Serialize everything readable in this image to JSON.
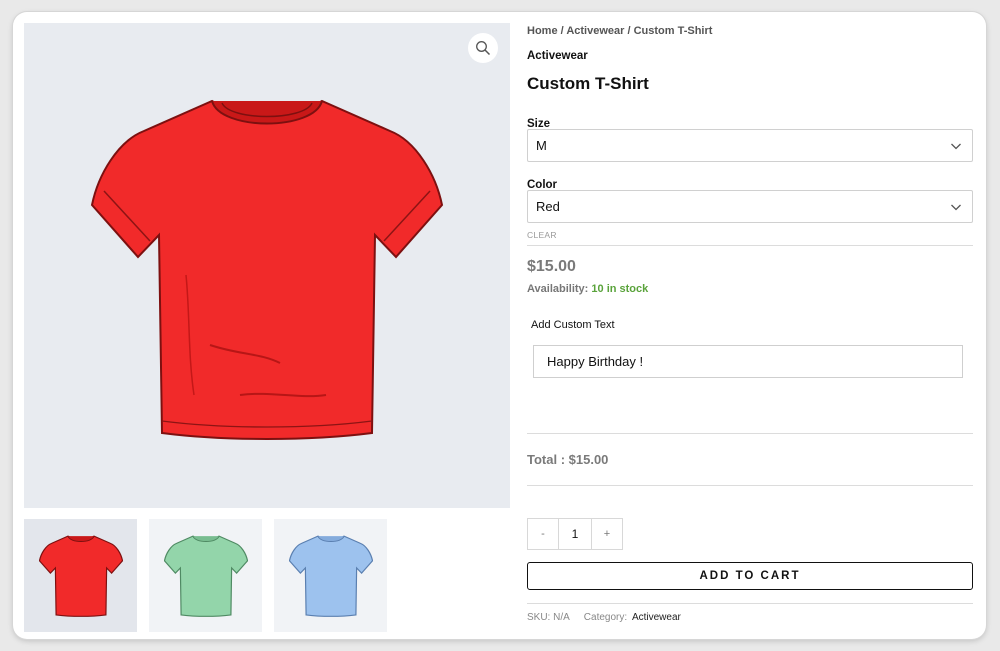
{
  "breadcrumb": {
    "home": "Home",
    "sep": " / ",
    "category": "Activewear",
    "current": "Custom T-Shirt"
  },
  "product": {
    "brand": "Activewear",
    "title": "Custom T-Shirt",
    "size_label": "Size",
    "size_value": "M",
    "color_label": "Color",
    "color_value": "Red",
    "clear_label": "CLEAR",
    "price": "$15.00",
    "availability_label": "Availability:",
    "availability_value": "10 in stock",
    "custom_text_label": "Add Custom Text",
    "custom_text_value": "Happy Birthday !",
    "total": "Total : $15.00",
    "qty_minus": "-",
    "qty_value": "1",
    "qty_plus": "+",
    "add_to_cart": "ADD TO CART",
    "sku": "SKU: N/A",
    "category_label": "Category:",
    "category_value": "Activewear"
  },
  "gallery": {
    "main_color": "#f12a2a",
    "thumbnails": [
      {
        "color": "#f12a2a",
        "name": "red"
      },
      {
        "color": "#93d5aa",
        "name": "green"
      },
      {
        "color": "#9dc2ee",
        "name": "blue"
      }
    ]
  },
  "icons": {
    "zoom": "magnifier-icon",
    "dropdown": "chevron-down-icon"
  },
  "colors": {
    "in_stock": "#5aa33b",
    "price": "#7a7a7a"
  }
}
